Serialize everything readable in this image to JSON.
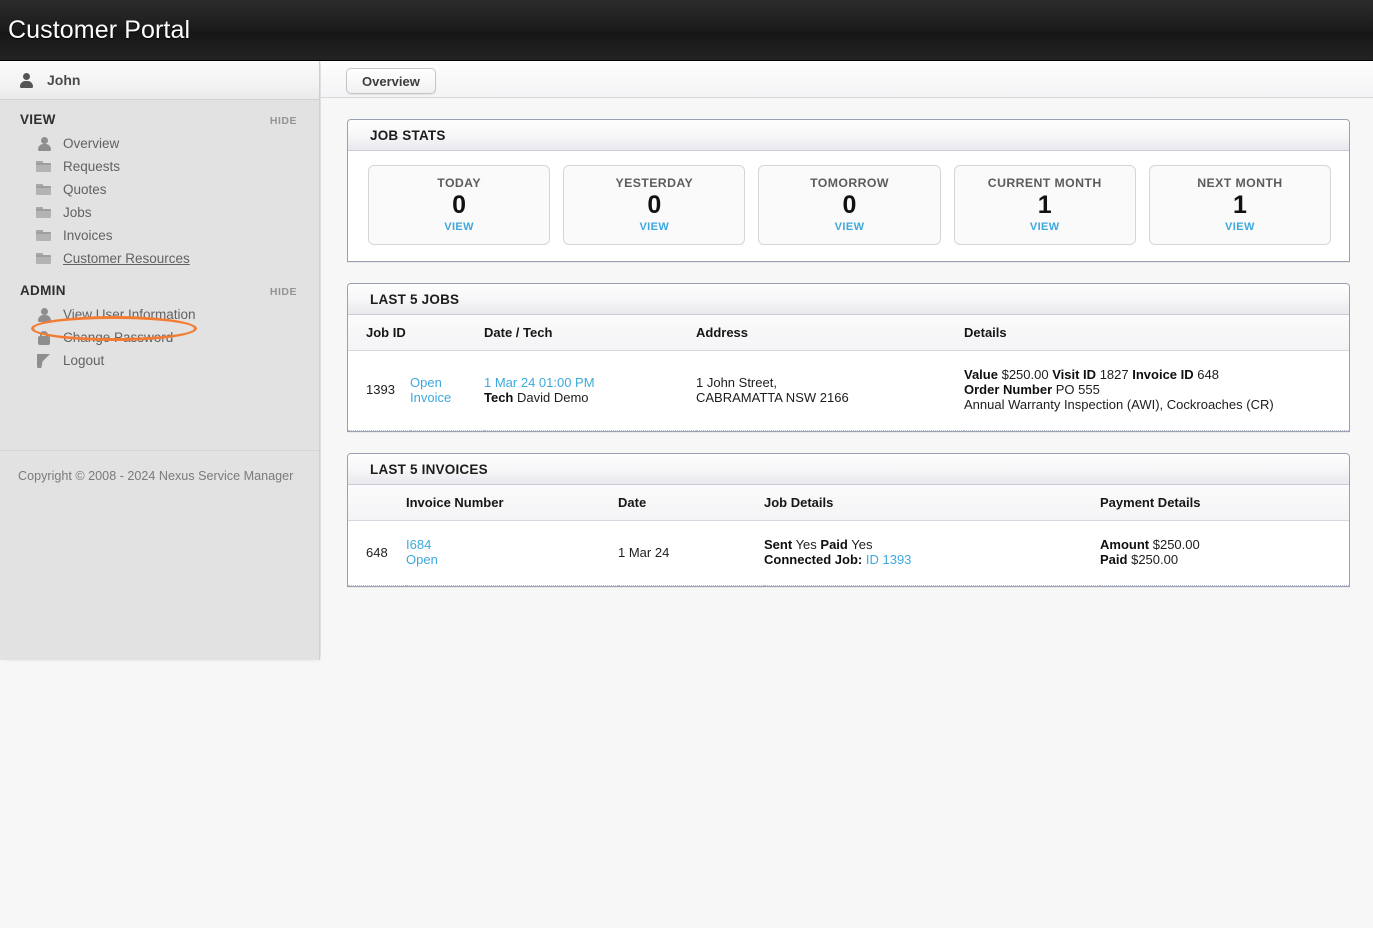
{
  "banner": {
    "title": "Customer Portal"
  },
  "sidebar": {
    "user": {
      "name": "John",
      "icon": "person-icon"
    },
    "sections": [
      {
        "title": "VIEW",
        "hide_label": "HIDE",
        "items": [
          {
            "label": "Overview",
            "icon": "person-icon",
            "current": false
          },
          {
            "label": "Requests",
            "icon": "folder-icon",
            "current": false
          },
          {
            "label": "Quotes",
            "icon": "folder-icon",
            "current": false
          },
          {
            "label": "Jobs",
            "icon": "folder-icon",
            "current": false
          },
          {
            "label": "Invoices",
            "icon": "folder-icon",
            "current": false
          },
          {
            "label": "Customer Resources",
            "icon": "folder-icon",
            "current": true
          }
        ]
      },
      {
        "title": "ADMIN",
        "hide_label": "HIDE",
        "items": [
          {
            "label": "View User Information",
            "icon": "person-icon"
          },
          {
            "label": "Change Password",
            "icon": "lock-icon"
          },
          {
            "label": "Logout",
            "icon": "logout-arrow-icon"
          }
        ]
      }
    ],
    "copyright": "Copyright © 2008 - 2024 Nexus Service Manager",
    "highlight_color": "#f47b32"
  },
  "main": {
    "tabs": [
      {
        "label": "Overview",
        "active": true
      }
    ],
    "job_stats": {
      "title": "JOB STATS",
      "boxes": [
        {
          "label": "TODAY",
          "value": "0",
          "link": "VIEW"
        },
        {
          "label": "YESTERDAY",
          "value": "0",
          "link": "VIEW"
        },
        {
          "label": "TOMORROW",
          "value": "0",
          "link": "VIEW"
        },
        {
          "label": "CURRENT MONTH",
          "value": "1",
          "link": "VIEW"
        },
        {
          "label": "NEXT MONTH",
          "value": "1",
          "link": "VIEW"
        }
      ]
    },
    "last_jobs": {
      "title": "LAST 5 JOBS",
      "columns": [
        "Job ID",
        "",
        "Date / Tech",
        "Address",
        "Details"
      ],
      "rows": [
        {
          "job_id": "1393",
          "action_open": "Open",
          "action_invoice": "Invoice",
          "datetime": "1 Mar 24 01:00 PM",
          "tech_label": "Tech",
          "tech_name": "David Demo",
          "address_line1": "1 John Street,",
          "address_line2": "CABRAMATTA NSW 2166",
          "value_label": "Value",
          "value": "$250.00",
          "visit_id_label": "Visit ID",
          "visit_id": "1827",
          "invoice_id_label": "Invoice ID",
          "invoice_id": "648",
          "order_number_label": "Order Number",
          "order_number": "PO 555",
          "services": "Annual Warranty Inspection (AWI), Cockroaches (CR)"
        }
      ]
    },
    "last_invoices": {
      "title": "LAST 5 INVOICES",
      "columns": [
        "",
        "Invoice Number",
        "Date",
        "Job Details",
        "Payment Details"
      ],
      "rows": [
        {
          "id": "648",
          "invoice_number": "I684",
          "action_open": "Open",
          "date": "1 Mar 24",
          "sent_label": "Sent",
          "sent": "Yes",
          "paid_label": "Paid",
          "paid": "Yes",
          "connected_job_label": "Connected Job:",
          "connected_job_id_label": "ID",
          "connected_job_id": "1393",
          "amount_label": "Amount",
          "amount": "$250.00",
          "paid_amount_label": "Paid",
          "paid_amount": "$250.00"
        }
      ]
    }
  }
}
